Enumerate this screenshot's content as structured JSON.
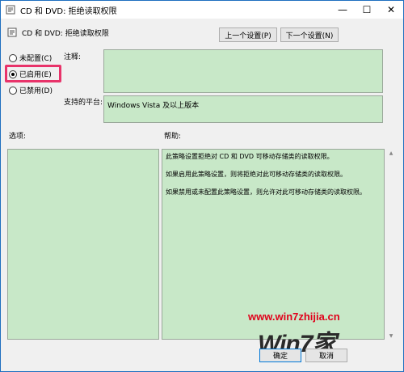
{
  "window": {
    "title": "CD 和 DVD: 拒绝读取权限"
  },
  "header": {
    "policy_name": "CD 和 DVD: 拒绝读取权限",
    "prev_button": "上一个设置(P)",
    "next_button": "下一个设置(N)"
  },
  "state": {
    "options": [
      {
        "label": "未配置(C)",
        "selected": false
      },
      {
        "label": "已启用(E)",
        "selected": true
      },
      {
        "label": "已禁用(D)",
        "selected": false
      }
    ]
  },
  "labels": {
    "comment": "注释:",
    "platform": "支持的平台:",
    "options": "选项:",
    "help": "帮助:"
  },
  "platform_value": "Windows Vista 及以上版本",
  "help_text": [
    "此策略设置拒绝对 CD 和 DVD 可移动存储类的读取权限。",
    "如果启用此策略设置，则将拒绝对此可移动存储类的读取权限。",
    "如果禁用或未配置此策略设置，则允许对此可移动存储类的读取权限。"
  ],
  "footer": {
    "ok_button": "确定",
    "cancel_button": "取消"
  },
  "watermark": {
    "url": "www.win7zhijia.cn",
    "logo_text": "Win7家"
  },
  "colors": {
    "green_field": "#c8e8c8",
    "highlight": "#e8336a",
    "watermark_red": "#e0001a"
  }
}
